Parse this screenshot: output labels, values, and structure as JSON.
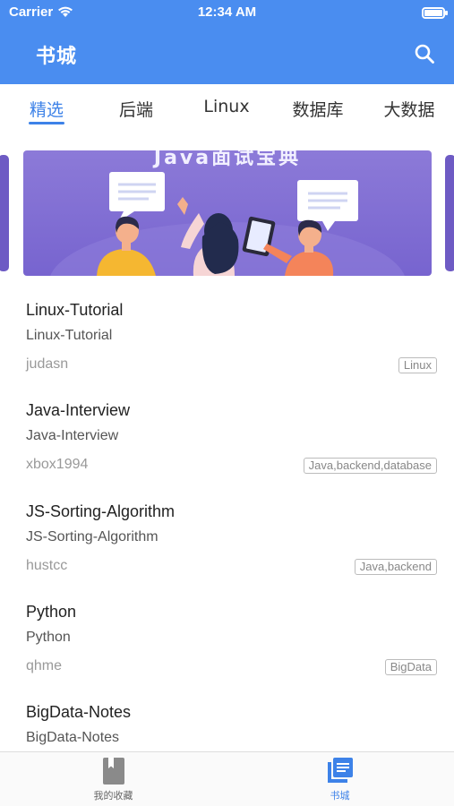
{
  "status_bar": {
    "carrier": "Carrier",
    "time": "12:34 AM"
  },
  "nav": {
    "title": "书城",
    "search_icon": "search-icon"
  },
  "tabs": [
    {
      "label": "精选",
      "active": true
    },
    {
      "label": "后端",
      "active": false
    },
    {
      "label": "Linux",
      "active": false
    },
    {
      "label": "数据库",
      "active": false
    },
    {
      "label": "大数据",
      "active": false
    }
  ],
  "banner": {
    "title": "Java面试宝典"
  },
  "books": [
    {
      "title": "Linux-Tutorial",
      "subtitle": "Linux-Tutorial",
      "author": "judasn",
      "tags": "Linux"
    },
    {
      "title": "Java-Interview",
      "subtitle": "Java-Interview",
      "author": "xbox1994",
      "tags": "Java,backend,database"
    },
    {
      "title": "JS-Sorting-Algorithm",
      "subtitle": "JS-Sorting-Algorithm",
      "author": "hustcc",
      "tags": "Java,backend"
    },
    {
      "title": "Python",
      "subtitle": "Python",
      "author": "qhme",
      "tags": "BigData"
    },
    {
      "title": "BigData-Notes",
      "subtitle": "BigData-Notes"
    }
  ],
  "tabbar": [
    {
      "label": "我的收藏",
      "icon": "bookmark-book-icon",
      "active": false
    },
    {
      "label": "书城",
      "icon": "library-icon",
      "active": true
    }
  ],
  "colors": {
    "primary": "#4a8df0",
    "accent": "#3d82e8",
    "banner": "#7764cf"
  }
}
